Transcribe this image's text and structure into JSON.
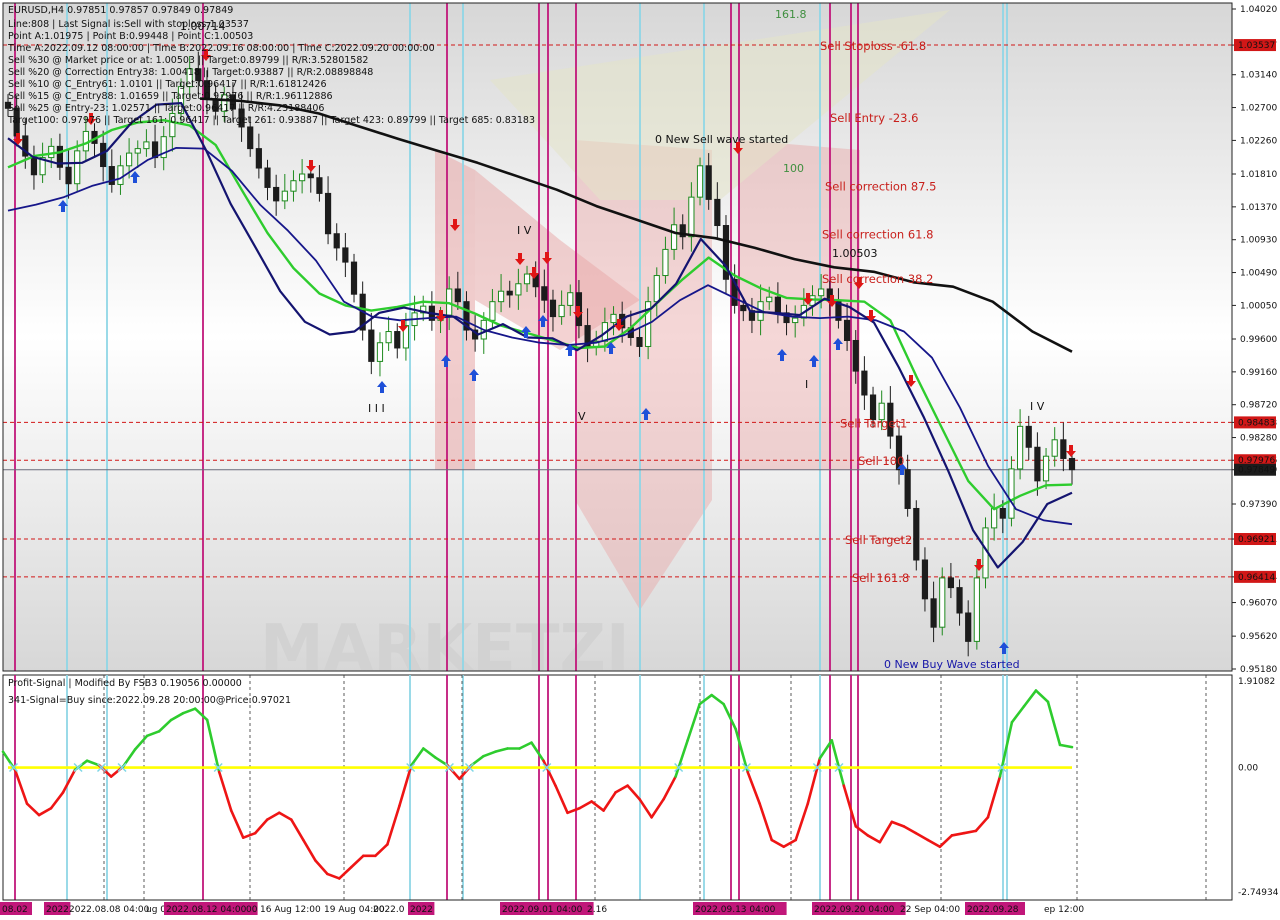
{
  "chart_data": [
    {
      "type": "candlestick",
      "symbol_line": "EURUSD,H4  0.97851 0.97857 0.97849 0.97849",
      "info_lines": [
        "Line:808 | Last Signal is:Sell with stoploss:1.03537",
        "Point A:1.01975 | Point B:0.99448 | Point C:1.00503",
        "Time A:2022.09.12 08:00:00 | Time B:2022.09.16 08:00:00 | Time C:2022.09.20 00:00:00",
        "Sell %30 @ Market price or at: 1.00503 || Target:0.89799 || R/R:3.52801582",
        "Sell %20 @ Correction Entry38: 1.00418 || Target:0.93887 || R/R:2.08898848",
        "Sell %10 @ C_Entry61: 1.0101 || Target:0.96417 || R/R:1.61812426",
        "Sell %15 @ C_Entry88: 1.01659 || Target:0.97976 || R/R:1.96112886",
        "Sell %25 @ Entry-23: 1.02571 || Target:0.96417 || R/R:4.23188406",
        "Target100: 0.97976 || Target 161: 0.96417 || Target 261: 0.93887 || Target 423: 0.89799 || Target 685: 0.83183"
      ],
      "y_ticks": [
        "1.04020",
        "1.03537",
        "1.03140",
        "1.02700",
        "1.02260",
        "1.01810",
        "1.01370",
        "1.00930",
        "1.00490",
        "1.00050",
        "0.99600",
        "0.99160",
        "0.98720",
        "0.98483",
        "0.98280",
        "0.97976",
        "0.97849",
        "0.97390",
        "0.96921",
        "0.96414",
        "0.96070",
        "0.95620",
        "0.95180"
      ],
      "y_range": [
        0.9518,
        1.0402
      ],
      "price_tags": [
        {
          "value": 1.03537,
          "label": "1.03537",
          "color": "#d11717"
        },
        {
          "value": 0.98483,
          "label": "0.98483",
          "color": "#d11717"
        },
        {
          "value": 0.97976,
          "label": "0.97976",
          "color": "#d11717"
        },
        {
          "value": 0.97849,
          "label": "0.97849",
          "color": "#1c1c1c"
        },
        {
          "value": 0.96921,
          "label": "0.96921",
          "color": "#d11717"
        },
        {
          "value": 0.96414,
          "label": "0.96414",
          "color": "#d11717"
        }
      ],
      "levels": [
        {
          "label": "Sell Stoploss -61.8",
          "value": 1.03537
        },
        {
          "label": "Sell Entry -23.6",
          "value": 1.02571
        },
        {
          "label": "Sell correction 87.5",
          "value": 1.01659
        },
        {
          "label": "Sell correction 61.8",
          "value": 1.0101
        },
        {
          "label": "Sell correction 38.2",
          "value": 1.00418
        },
        {
          "label": "Sell Target1",
          "value": 0.98483
        },
        {
          "label": "Sell 100",
          "value": 0.97976
        },
        {
          "label": "Sell Target2",
          "value": 0.96921
        },
        {
          "label": "Sell 161.8",
          "value": 0.96414
        }
      ],
      "annotations": [
        {
          "label": "161.8",
          "color": "#3f8f3f"
        },
        {
          "label": "100",
          "color": "#3f8f3f"
        },
        {
          "label": "0 New Sell wave started",
          "color": "#111111"
        },
        {
          "label": "1.00503",
          "color": "#111111"
        },
        {
          "label": "0 New Buy Wave started",
          "color": "#1616a8"
        },
        {
          "label": "1.00714",
          "color": "#111111"
        }
      ],
      "wave_labels": [
        "I I I",
        "I V",
        "V",
        "I",
        "I V"
      ],
      "series": [
        {
          "name": "close",
          "values": [
            1.0269,
            1.0232,
            1.0205,
            1.018,
            1.0203,
            1.0218,
            1.019,
            1.0168,
            1.0212,
            1.0238,
            1.0222,
            1.0191,
            1.0167,
            1.0192,
            1.0209,
            1.0215,
            1.0224,
            1.0203,
            1.0231,
            1.0262,
            1.0298,
            1.0322,
            1.0306,
            1.0281,
            1.0265,
            1.0287,
            1.0268,
            1.0244,
            1.0215,
            1.0189,
            1.0163,
            1.0145,
            1.0158,
            1.0172,
            1.0181,
            1.0176,
            1.0155,
            1.0101,
            1.0082,
            1.0063,
            1.002,
            0.9972,
            0.993,
            0.9955,
            0.997,
            0.9948,
            0.9978,
            0.9995,
            1.0004,
            0.9985,
            0.9992,
            1.0027,
            1.001,
            0.9972,
            0.996,
            0.9985,
            1.001,
            1.0024,
            1.0019,
            1.0034,
            1.0047,
            1.003,
            1.0012,
            0.999,
            1.0005,
            1.0022,
            0.9978,
            0.9949,
            0.9957,
            0.9982,
            0.9993,
            0.9975,
            0.9962,
            0.995,
            1.001,
            1.0045,
            1.008,
            1.0113,
            1.0097,
            1.015,
            1.0192,
            1.0147,
            1.0112,
            1.004,
            1.0005,
            0.9998,
            0.9985,
            1.001,
            1.0016,
            0.9995,
            0.9982,
            0.9988,
            1.0005,
            1.0018,
            1.0027,
            1.0011,
            0.9985,
            0.9958,
            0.9917,
            0.9885,
            0.9852,
            0.9874,
            0.983,
            0.9785,
            0.9733,
            0.9664,
            0.9612,
            0.9574,
            0.964,
            0.9627,
            0.9593,
            0.9555,
            0.964,
            0.9707,
            0.9733,
            0.972,
            0.9786,
            0.9843,
            0.9815,
            0.977,
            0.9803,
            0.9825,
            0.98,
            0.9785
          ]
        },
        {
          "name": "black MA",
          "values": [
            1.0282,
            1.0279,
            1.0273,
            1.0262,
            1.0245,
            1.0228,
            1.0212,
            1.0196,
            1.0178,
            1.016,
            1.0138,
            1.012,
            1.0102,
            1.0095,
            1.0082,
            1.0067,
            1.0056,
            1.005,
            1.0036,
            1.003,
            1.001,
            0.997,
            0.9943
          ]
        },
        {
          "name": "navy MA",
          "values": [
            1.0229,
            1.0204,
            1.0195,
            1.0196,
            1.0212,
            1.025,
            1.0274,
            1.0276,
            1.0213,
            1.0141,
            1.0083,
            1.0024,
            0.9983,
            0.9966,
            0.997,
            0.9995,
            1.0002,
            0.9995,
            0.999,
            0.9966,
            0.998,
            0.9962,
            0.9961,
            0.9945,
            0.9965,
            0.999,
            1.0001,
            1.0034,
            1.0094,
            1.0058,
            0.9997,
            0.9995,
            0.9992,
            1.0014,
            1.0003,
            0.9982,
            0.9922,
            0.9856,
            0.9783,
            0.9704,
            0.9654,
            0.9688,
            0.9739,
            0.9754
          ]
        },
        {
          "name": "blue MA",
          "values": [
            1.0132,
            1.014,
            1.015,
            1.0165,
            1.0175,
            1.02,
            1.0216,
            1.0215,
            1.0185,
            1.014,
            1.0105,
            1.0065,
            1.001,
            0.999,
            0.9985,
            0.9988,
            0.999,
            0.9972,
            0.9962,
            0.9955,
            0.9952,
            0.9955,
            0.9965,
            0.9983,
            1.0012,
            1.0032,
            1.0014,
            0.9996,
            0.999,
            0.9988,
            0.999,
            0.9985,
            0.997,
            0.9935,
            0.9868,
            0.979,
            0.9732,
            0.9717,
            0.9712
          ]
        },
        {
          "name": "green MA",
          "values": [
            1.019,
            1.0205,
            1.021,
            1.0222,
            1.024,
            1.025,
            1.0253,
            1.0246,
            1.022,
            1.016,
            1.0102,
            1.0055,
            1.0021,
            1.0005,
            0.9998,
            1.0003,
            1.001,
            1.0008,
            0.9994,
            0.9978,
            0.9968,
            0.9958,
            0.9948,
            0.995,
            0.9975,
            1.0008,
            1.004,
            1.0069,
            1.0045,
            1.0028,
            1.0015,
            1.0013,
            1.0012,
            1.001,
            0.9985,
            0.991,
            0.984,
            0.977,
            0.9732,
            0.975,
            0.9764,
            0.9765
          ]
        }
      ]
    },
    {
      "type": "line",
      "title_line": "Profit-Signal | Modified By FSB3 0.19056 0.00000",
      "signal_line": "341-Signal=Buy since:2022.09.28 20:00:00@Price:0.97021",
      "y_ticks": [
        "1.91082",
        "0.00",
        "-2.74934"
      ],
      "y_range": [
        -2.74934,
        1.91082
      ],
      "zero_level": 0,
      "series": [
        {
          "name": "oscillator",
          "values": [
            0.35,
            -0.05,
            -0.8,
            -1.05,
            -0.9,
            -0.55,
            -0.05,
            0.15,
            0.05,
            -0.2,
            0.02,
            0.4,
            0.7,
            0.8,
            1.05,
            1.2,
            1.3,
            1.05,
            -0.1,
            -0.95,
            -1.55,
            -1.45,
            -1.15,
            -1.0,
            -1.15,
            -1.6,
            -2.05,
            -2.35,
            -2.45,
            -2.2,
            -1.95,
            -1.95,
            -1.7,
            -0.85,
            0.05,
            0.42,
            0.22,
            0.05,
            -0.25,
            0.05,
            0.25,
            0.35,
            0.42,
            0.42,
            0.55,
            0.15,
            -0.4,
            -1.0,
            -0.9,
            -0.75,
            -0.95,
            -0.55,
            -0.4,
            -0.7,
            -1.1,
            -0.7,
            -0.2,
            0.6,
            1.4,
            1.6,
            1.4,
            0.85,
            -0.1,
            -0.8,
            -1.6,
            -1.75,
            -1.6,
            -0.8,
            0.2,
            0.6,
            -0.4,
            -1.3,
            -1.5,
            -1.65,
            -1.2,
            -1.3,
            -1.45,
            -1.6,
            -1.75,
            -1.5,
            -1.45,
            -1.4,
            -1.1,
            -0.2,
            1.0,
            1.35,
            1.7,
            1.45,
            0.5,
            0.45
          ]
        }
      ]
    }
  ],
  "x_axis_labels": [
    "08.02",
    "2022",
    "2022.08.08 04:00",
    "ug 0",
    "2022.08.12 04:00",
    "00",
    "16 Aug 12:00",
    "19 Aug 04:00",
    "2022.0",
    "2022",
    "2022.09.01 04:00",
    "2.16",
    "2022.09.13 04:00",
    "2022.09.20 04:00",
    "22 Sep 04:00",
    "2022.09.28",
    "ep 12:00"
  ],
  "colors": {
    "up": "#1e8a1e",
    "down": "#1c1c1c",
    "magenta": "#c1177a",
    "cyan": "#8fd6e6",
    "red": "#d11717",
    "green": "#2ecc2e",
    "yellow": "#ffff00",
    "navy": "#16168a",
    "blue": "#1f3fa6"
  }
}
